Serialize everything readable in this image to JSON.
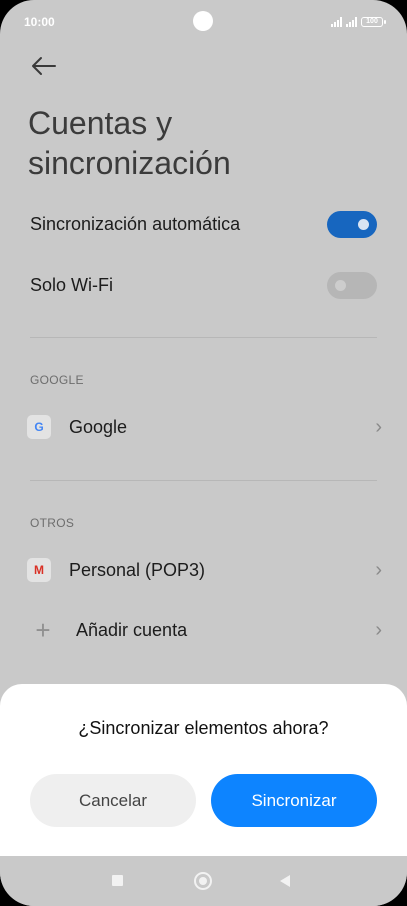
{
  "status": {
    "time": "10:00",
    "battery": "100"
  },
  "page": {
    "title_line1": "Cuentas y",
    "title_line2": "sincronización"
  },
  "settings": {
    "auto_sync_label": "Sincronización automática",
    "auto_sync_on": true,
    "wifi_only_label": "Solo Wi-Fi",
    "wifi_only_on": false
  },
  "sections": {
    "google_header": "GOOGLE",
    "others_header": "OTROS"
  },
  "accounts": {
    "google_label": "Google",
    "google_icon_glyph": "G",
    "personal_label": "Personal (POP3)",
    "personal_icon_glyph": "M",
    "add_label": "Añadir cuenta"
  },
  "dialog": {
    "title": "¿Sincronizar elementos ahora?",
    "cancel_label": "Cancelar",
    "confirm_label": "Sincronizar"
  },
  "colors": {
    "accent": "#0d84ff",
    "toggle_on": "#1766bf",
    "dim_background": "#c9c9c9"
  }
}
